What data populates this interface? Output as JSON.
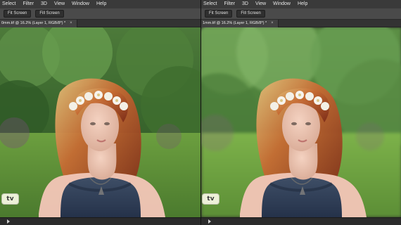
{
  "menu": {
    "left": [
      "Select",
      "Filter",
      "3D",
      "View",
      "Window",
      "Help"
    ],
    "right": [
      "Select",
      "Filter",
      "3D",
      "View",
      "Window",
      "Help"
    ]
  },
  "options": {
    "left": {
      "fit_screen": "Fit Screen",
      "fill_screen": "Fill Screen"
    },
    "right": {
      "fit_screen": "Fit Screen",
      "fill_screen": "Fill Screen"
    }
  },
  "documents": {
    "left": {
      "tab_label": "0mm.tif @ 16.2% (Layer 1, RGB/8*) *",
      "close_glyph": "×"
    },
    "right": {
      "tab_label": "1mm.tif @ 16.2% (Layer 1, RGB/8*) *",
      "close_glyph": "×"
    }
  },
  "watermark": {
    "left": "tv",
    "right": "tv"
  },
  "colors": {
    "ui_dark": "#2b2b2b",
    "menubar": "#3a3a3a",
    "optionsbar": "#4a4a4a",
    "foliage": "#3f6f2f",
    "hair": "#b04a22",
    "dress": "#2f3f55"
  },
  "icons": {
    "tab_close": "close-icon",
    "scroll_arrow": "scroll-arrow-icon"
  }
}
